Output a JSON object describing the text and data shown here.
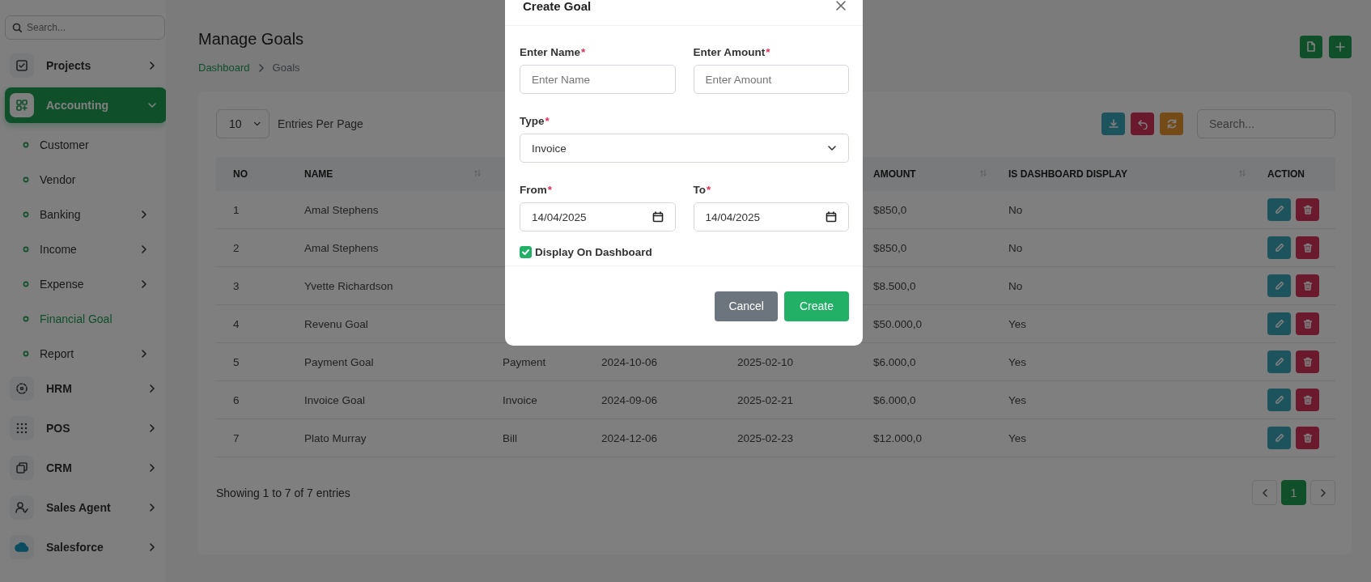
{
  "sidebar": {
    "search": {
      "placeholder": "Search..."
    },
    "items": [
      {
        "label": "Projects",
        "selected": false,
        "expanded": false
      },
      {
        "label": "Accounting",
        "selected": true,
        "expanded": true,
        "children": [
          {
            "label": "Customer",
            "selected": false,
            "has_submenu": false
          },
          {
            "label": "Vendor",
            "selected": false,
            "has_submenu": false
          },
          {
            "label": "Banking",
            "selected": false,
            "has_submenu": true
          },
          {
            "label": "Income",
            "selected": false,
            "has_submenu": true
          },
          {
            "label": "Expense",
            "selected": false,
            "has_submenu": true
          },
          {
            "label": "Financial Goal",
            "selected": true,
            "has_submenu": false
          },
          {
            "label": "Report",
            "selected": false,
            "has_submenu": true
          }
        ]
      },
      {
        "label": "HRM",
        "selected": false,
        "expanded": false
      },
      {
        "label": "POS",
        "selected": false,
        "expanded": false
      },
      {
        "label": "CRM",
        "selected": false,
        "expanded": false
      },
      {
        "label": "Sales Agent",
        "selected": false,
        "expanded": false
      },
      {
        "label": "Salesforce",
        "selected": false,
        "expanded": false
      }
    ]
  },
  "header": {
    "title": "Manage Goals",
    "breadcrumb": [
      {
        "label": "Dashboard",
        "link": true
      },
      {
        "label": "Goals",
        "link": false
      }
    ]
  },
  "table": {
    "page_size": "10",
    "page_size_label": "Entries Per Page",
    "search": {
      "placeholder": "Search..."
    },
    "columns": [
      {
        "label": "NO",
        "sortable": false
      },
      {
        "label": "NAME",
        "sortable": true
      },
      null,
      null,
      null,
      {
        "label": "AMOUNT",
        "sortable": true
      },
      {
        "label": "IS DASHBOARD DISPLAY",
        "sortable": true
      },
      {
        "label": "ACTION",
        "sortable": false
      }
    ],
    "rows": [
      {
        "no": "1",
        "name": "Amal Stephens",
        "amount": "$850,0",
        "dashboard_display": "No"
      },
      {
        "no": "2",
        "name": "Amal Stephens",
        "amount": "$850,0",
        "dashboard_display": "No"
      },
      {
        "no": "3",
        "name": "Yvette Richardson",
        "amount": "$8.500,0",
        "dashboard_display": "No"
      },
      {
        "no": "4",
        "name": "Revenu Goal",
        "amount": "$50.000,0",
        "dashboard_display": "Yes"
      },
      {
        "no": "5",
        "name": "Payment Goal",
        "type": "Payment",
        "from": "2024-10-06",
        "to": "2025-02-10",
        "amount": "$6.000,0",
        "dashboard_display": "Yes"
      },
      {
        "no": "6",
        "name": "Invoice Goal",
        "type": "Invoice",
        "from": "2024-09-06",
        "to": "2025-02-21",
        "amount": "$6.000,0",
        "dashboard_display": "Yes"
      },
      {
        "no": "7",
        "name": "Plato Murray",
        "type": "Bill",
        "from": "2024-12-06",
        "to": "2025-02-23",
        "amount": "$12.000,0",
        "dashboard_display": "Yes"
      }
    ],
    "summary": "Showing 1 to 7 of 7 entries",
    "pages": [
      {
        "label": "1",
        "selected": true
      }
    ]
  },
  "modal": {
    "title": "Create Goal",
    "fields": [
      {
        "kind": "text",
        "label": "Enter Name",
        "required_mark": "*",
        "placeholder": "Enter Name"
      },
      {
        "kind": "text",
        "label": "Enter Amount",
        "required_mark": "*",
        "placeholder": "Enter Amount"
      },
      {
        "kind": "select",
        "label": "Type",
        "required_mark": "*",
        "value": "Invoice"
      },
      {
        "kind": "date",
        "label": "From",
        "required_mark": "*",
        "value": "14/04/2025"
      },
      {
        "kind": "date",
        "label": "To",
        "required_mark": "*",
        "value": "14/04/2025"
      },
      {
        "kind": "checkbox",
        "label": "Display On Dashboard",
        "checked": true
      }
    ],
    "buttons": [
      {
        "label": "Cancel",
        "kind": "secondary"
      },
      {
        "label": "Create",
        "kind": "primary"
      }
    ]
  }
}
